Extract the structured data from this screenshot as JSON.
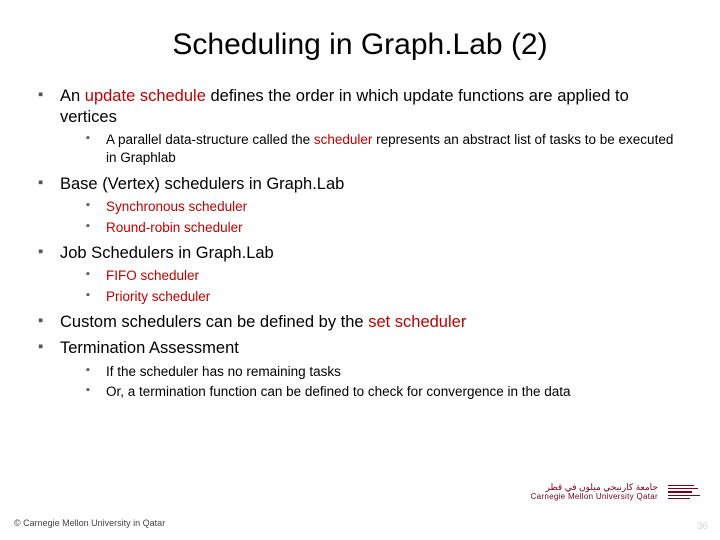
{
  "title": "Scheduling in Graph.Lab (2)",
  "bullets": [
    {
      "pre": "An ",
      "accent": "update schedule",
      "post": " defines the order in which update functions are applied to vertices",
      "sub": [
        {
          "pre": "A parallel data-structure called the ",
          "accent": "scheduler",
          "post": " represents an abstract list of tasks to be executed in Graphlab"
        }
      ]
    },
    {
      "pre": "Base (Vertex) schedulers in Graph.Lab",
      "sub": [
        {
          "accent": "Synchronous scheduler"
        },
        {
          "accent": "Round-robin scheduler"
        }
      ]
    },
    {
      "pre": "Job Schedulers in Graph.Lab",
      "sub": [
        {
          "accent": "FIFO scheduler"
        },
        {
          "accent": "Priority scheduler"
        }
      ]
    },
    {
      "pre": "Custom schedulers can be defined by the ",
      "accent": "set scheduler"
    },
    {
      "pre": "Termination Assessment",
      "sub": [
        {
          "pre": "If the scheduler has no remaining tasks"
        },
        {
          "pre": "Or, a termination function can be defined to check for convergence in the data"
        }
      ]
    }
  ],
  "footer": "© Carnegie Mellon University in Qatar",
  "pagenum": "36",
  "logo": {
    "line_ar": "جامعة كارنيجي ميلون في قطر",
    "line_en": "Carnegie Mellon University Qatar"
  }
}
